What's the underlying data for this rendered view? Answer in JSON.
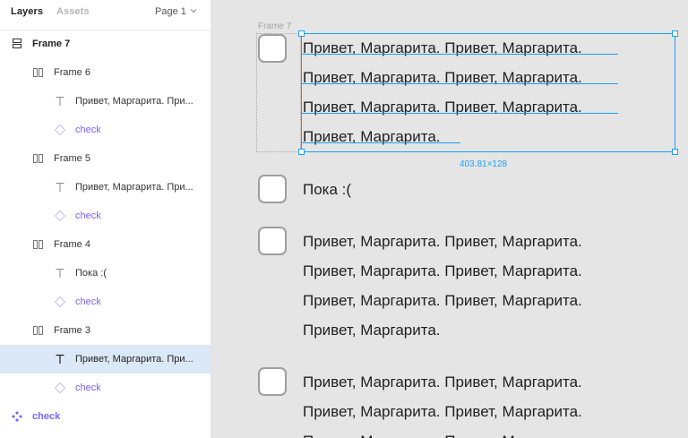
{
  "panel": {
    "tabs": {
      "layers": "Layers",
      "assets": "Assets"
    },
    "page_selector": "Page 1",
    "layers": [
      {
        "label": "Frame 7",
        "type": "frame",
        "icon": "rows-icon"
      },
      {
        "label": "Frame 6",
        "type": "autolayout",
        "icon": "columns-icon"
      },
      {
        "label": "Привет, Маргарита. При...",
        "type": "text",
        "icon": "text-icon"
      },
      {
        "label": "check",
        "type": "component",
        "icon": "instance-icon"
      },
      {
        "label": "Frame 5",
        "type": "autolayout",
        "icon": "columns-icon"
      },
      {
        "label": "Привет, Маргарита. При...",
        "type": "text",
        "icon": "text-icon"
      },
      {
        "label": "check",
        "type": "component",
        "icon": "instance-icon"
      },
      {
        "label": "Frame 4",
        "type": "autolayout",
        "icon": "columns-icon"
      },
      {
        "label": "Пока :(",
        "type": "text",
        "icon": "text-icon"
      },
      {
        "label": "check",
        "type": "component",
        "icon": "instance-icon"
      },
      {
        "label": "Frame 3",
        "type": "autolayout",
        "icon": "columns-icon"
      },
      {
        "label": "Привет, Маргарита. При...",
        "type": "text",
        "icon": "text-icon",
        "selected": true
      },
      {
        "label": "check",
        "type": "component",
        "icon": "instance-icon"
      },
      {
        "label": "check",
        "type": "main-component",
        "icon": "component-icon"
      }
    ]
  },
  "canvas": {
    "frame_label": "Frame 7",
    "selection_size": "403.81×128",
    "item1_lines": [
      "Привет, Маргарита. Привет, Маргарита.",
      "Привет, Маргарита. Привет, Маргарита.",
      "Привет, Маргарита. Привет, Маргарита.",
      "Привет, Маргарита."
    ],
    "item2_lines": [
      "Пока :("
    ],
    "item3_lines": [
      "Привет, Маргарита. Привет, Маргарита.",
      "Привет, Маргарита. Привет, Маргарита.",
      "Привет, Маргарита. Привет, Маргарита.",
      "Привет, Маргарита."
    ],
    "item4_lines": [
      "Привет, Маргарита. Привет, Маргарита.",
      "Привет, Маргарита. Привет, Маргарита.",
      "Привет, Маргарита. Привет, Маргарита."
    ]
  },
  "colors": {
    "selection": "#18a0fb",
    "component": "#7b61ff",
    "selected_row": "#dbe8f7"
  }
}
